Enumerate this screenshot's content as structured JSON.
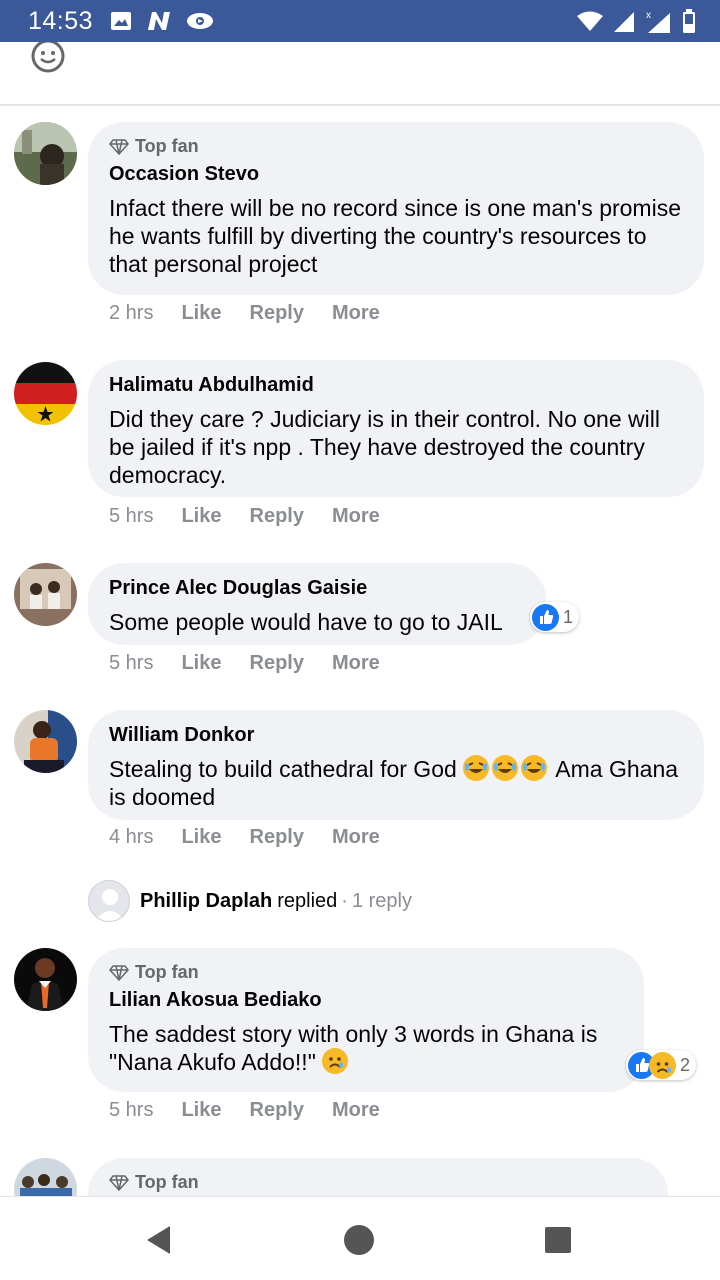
{
  "status_bar": {
    "time": "14:53",
    "left_icons": [
      "image-icon",
      "n-notification-icon",
      "media-icon"
    ],
    "right_icons": [
      "wifi-icon",
      "signal-icon",
      "signal-no-data-icon",
      "battery-icon"
    ]
  },
  "comments": [
    {
      "badge": "Top fan",
      "author": "Occasion Stevo",
      "text": "Infact there will be no record since is one man's promise he wants fulfill by diverting the country's resources to that personal project",
      "time": "2 hrs",
      "like": "Like",
      "reply": "Reply",
      "more": "More"
    },
    {
      "badge": "",
      "author": "Halimatu Abdulhamid",
      "text": "Did they care ? Judiciary is in their control. No one will be jailed if it's npp . They have destroyed the country democracy.",
      "time": "5 hrs",
      "like": "Like",
      "reply": "Reply",
      "more": "More"
    },
    {
      "badge": "",
      "author": "Prince Alec Douglas Gaisie",
      "text": "Some people would have to go to JAIL",
      "time": "5 hrs",
      "like": "Like",
      "reply": "Reply",
      "more": "More",
      "reaction_count": "1"
    },
    {
      "badge": "",
      "author": "William Donkor",
      "text_before": "Stealing to build cathedral for God",
      "text_after": "Ama Ghana is doomed",
      "time": "4 hrs",
      "like": "Like",
      "reply": "Reply",
      "more": "More"
    },
    {
      "badge": "Top fan",
      "author": "Lilian Akosua Bediako",
      "text": "The saddest story with only 3 words in Ghana is \"Nana Akufo Addo!!\"",
      "time": "5 hrs",
      "like": "Like",
      "reply": "Reply",
      "more": "More",
      "reaction_count": "2"
    },
    {
      "badge": "Top fan"
    }
  ],
  "replied": {
    "name": "Phillip Daplah",
    "action": "replied",
    "separator": "·",
    "count": "1 reply"
  },
  "colors": {
    "status_bar": "#3b5998",
    "bubble": "#f0f2f5",
    "meta_text": "#8a8d91",
    "like_blue": "#1877f2"
  }
}
